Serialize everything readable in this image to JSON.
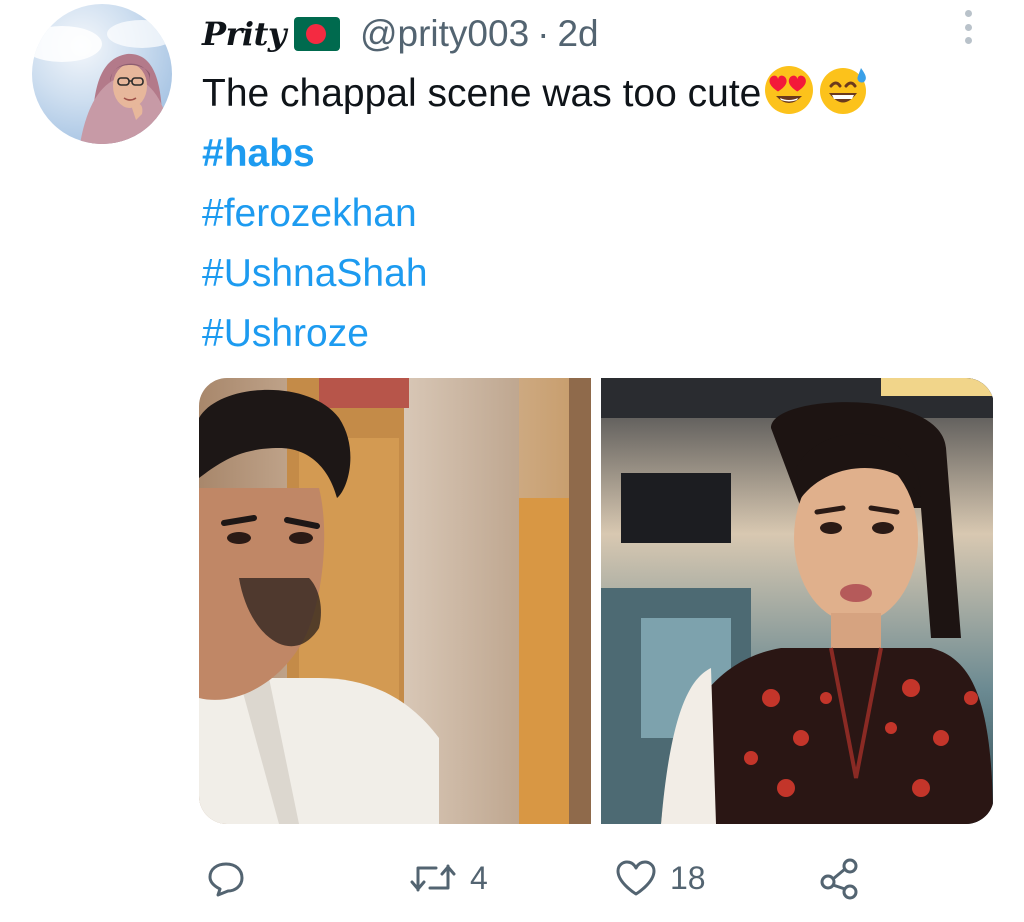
{
  "tweet": {
    "display_name": "Prity",
    "flag_icon": "bangladesh-flag-icon",
    "handle": "@prity003",
    "separator": "·",
    "age": "2d",
    "text": "The chappal scene was too cute",
    "emojis": [
      "heart-eyes-emoji",
      "grinning-sweat-emoji"
    ],
    "hashtags": [
      "#habs",
      "#ferozekhan",
      "#UshnaShah",
      "#Ushroze"
    ]
  },
  "media": {
    "photos": [
      "man-in-white-shirt-photo",
      "woman-in-red-black-kurta-photo"
    ]
  },
  "actions": {
    "reply_count": "",
    "retweet_count": "4",
    "like_count": "18",
    "share_count": ""
  },
  "colors": {
    "link": "#1d9bf0",
    "text": "#0f1419",
    "secondary": "#536471"
  }
}
